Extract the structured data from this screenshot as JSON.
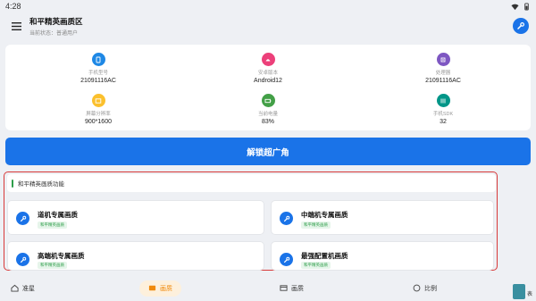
{
  "status_bar": {
    "time": "4:28"
  },
  "app_bar": {
    "title": "和平精英画质区",
    "subtitle": "当前状态：普通用户"
  },
  "info": [
    {
      "label": "手机型号",
      "value": "21091116AC",
      "icon": "phone-icon",
      "color": "#1e88e5"
    },
    {
      "label": "安卓版本",
      "value": "Android12",
      "icon": "android-icon",
      "color": "#ec407a"
    },
    {
      "label": "处理器",
      "value": "21091116AC",
      "icon": "chip-icon",
      "color": "#7e57c2"
    },
    {
      "label": "屏幕分辨率",
      "value": "900*1600",
      "icon": "screen-icon",
      "color": "#fbc02d"
    },
    {
      "label": "当前电量",
      "value": "83%",
      "icon": "battery-icon",
      "color": "#43a047"
    },
    {
      "label": "手机SDK",
      "value": "32",
      "icon": "sdk-icon",
      "color": "#009688"
    }
  ],
  "unlock_button": "解锁超广角",
  "section": {
    "title": "和平精英画质功能"
  },
  "features": [
    {
      "title": "道机专属画质",
      "tag": "和平精英画质"
    },
    {
      "title": "中端机专属画质",
      "tag": "和平精英画质"
    },
    {
      "title": "高端机专属画质",
      "tag": "和平精英画质"
    },
    {
      "title": "最强配置机画质",
      "tag": "和平精英画质"
    }
  ],
  "nav": [
    {
      "label": "准星",
      "icon": "home-icon"
    },
    {
      "label": "画质",
      "icon": "picture-icon",
      "active": true
    },
    {
      "label": "画质",
      "icon": "window-icon"
    },
    {
      "label": "比例",
      "icon": "face-icon"
    }
  ],
  "floating": {
    "tag": "表"
  },
  "colors": {
    "primary": "#1a73e8",
    "accent": "#f0890a",
    "highlight_border": "#d83a3a",
    "green": "#2e9e4a"
  }
}
